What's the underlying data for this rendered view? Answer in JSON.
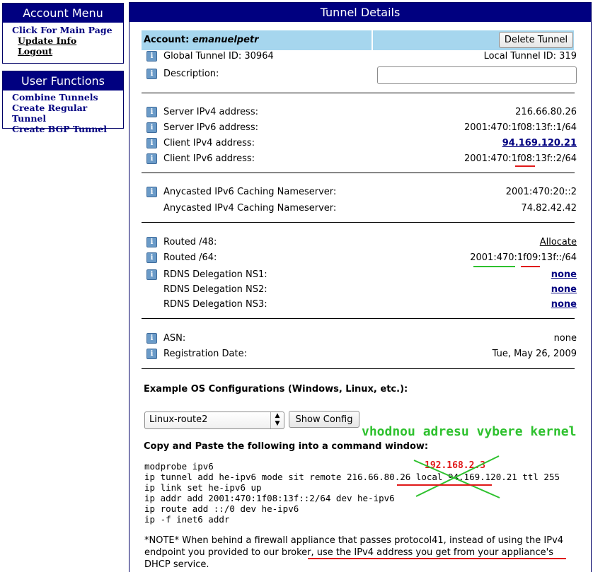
{
  "account_menu": {
    "title": "Account Menu",
    "main_page": "Click For Main Page",
    "update_info": "Update Info",
    "logout": "Logout"
  },
  "user_functions": {
    "title": "User Functions",
    "items": [
      "Combine Tunnels",
      "Create Regular Tunnel",
      "Create BGP Tunnel"
    ]
  },
  "tunnel": {
    "title": "Tunnel Details",
    "account_label": "Account:",
    "account_name": "emanuelpetr",
    "delete_button": "Delete Tunnel",
    "global_id_label": "Global Tunnel ID: 30964",
    "local_id_label": "Local Tunnel ID: 319",
    "description_label": "Description:",
    "description_value": "",
    "server_ipv4_label": "Server IPv4 address:",
    "server_ipv4": "216.66.80.26",
    "server_ipv6_label": "Server IPv6 address:",
    "server_ipv6": "2001:470:1f08:13f::1/64",
    "client_ipv4_label": "Client IPv4 address:",
    "client_ipv4": "94.169.120.21",
    "client_ipv6_label": "Client IPv6 address:",
    "client_ipv6": "2001:470:1f08:13f::2/64",
    "anycast_v6_label": "Anycasted IPv6 Caching Nameserver:",
    "anycast_v6": "2001:470:20::2",
    "anycast_v4_label": "Anycasted IPv4 Caching Nameserver:",
    "anycast_v4": "74.82.42.42",
    "routed48_label": "Routed /48:",
    "routed48": "Allocate",
    "routed64_label": "Routed /64:",
    "routed64": "2001:470:1f09:13f::/64",
    "rdns1_label": "RDNS Delegation NS1:",
    "rdns1": "none",
    "rdns2_label": "RDNS Delegation NS2:",
    "rdns2": "none",
    "rdns3_label": "RDNS Delegation NS3:",
    "rdns3": "none",
    "asn_label": "ASN:",
    "asn": "none",
    "reg_label": "Registration Date:",
    "reg": "Tue, May 26, 2009"
  },
  "config": {
    "title": "Example OS Configurations (Windows, Linux, etc.):",
    "selected_os": "Linux-route2",
    "show_button": "Show Config",
    "copy_title": "Copy and Paste the following into a command window:",
    "code": "modprobe ipv6\nip tunnel add he-ipv6 mode sit remote 216.66.80.26 local 94.169.120.21 ttl 255\nip link set he-ipv6 up\nip addr add 2001:470:1f08:13f::2/64 dev he-ipv6\nip route add ::/0 dev he-ipv6\nip -f inet6 addr",
    "note": "*NOTE* When behind a firewall appliance that passes protocol41, instead of using the IPv4 endpoint you provided to our broker, use the IPv4 address you get from your appliance's DHCP service."
  },
  "annotations": {
    "green_text": "vhodnou adresu vybere kernel",
    "red_text": "192.168.2.3",
    "green_color": "#2ec12e",
    "red_color": "#e01818"
  },
  "icons": {
    "info": "info-icon",
    "select_arrow": "updown-arrows-icon"
  },
  "colors": {
    "header_bg": "#000080",
    "account_bar": "#a6d6ee",
    "link": "#000080"
  }
}
